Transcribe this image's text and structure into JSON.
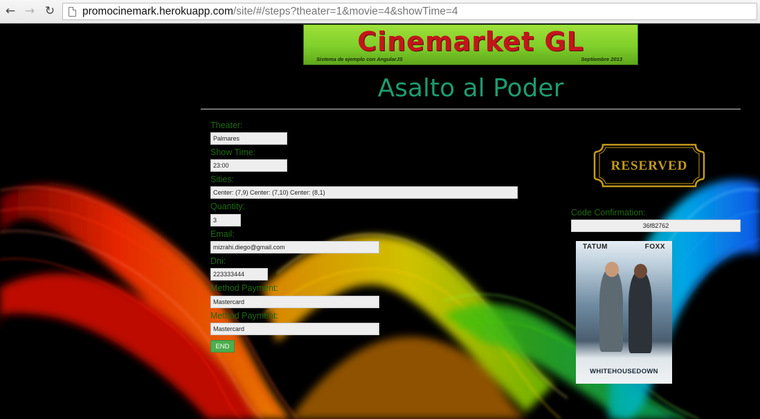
{
  "browser": {
    "url_host": "promocinemark.herokuapp.com",
    "url_path": "/site/#/steps?theater=1&movie=4&showTime=4"
  },
  "banner": {
    "title": "Cinemarket GL",
    "subtitle": "Sistema de ejemplo con AngularJS",
    "date": "Septiembre 2013"
  },
  "movie_title": "Asalto al Poder",
  "form": {
    "theater": {
      "label": "Theater:",
      "value": "Palmares"
    },
    "show_time": {
      "label": "Show Time:",
      "value": "23:00"
    },
    "sities": {
      "label": "Sities:",
      "value": "Center: (7,9) Center: (7,10) Center: (8,1)"
    },
    "quantity": {
      "label": "Quantity:",
      "value": "3"
    },
    "email": {
      "label": "Email:",
      "value": "mizrahi.diego@gmail.com"
    },
    "dni": {
      "label": "Dni:",
      "value": "223333444"
    },
    "method_payment_1": {
      "label": "Method Payment:",
      "value": "Mastercard"
    },
    "method_payment_2": {
      "label": "Method Payment:",
      "value": "Mastercard"
    },
    "end_button": "END"
  },
  "confirmation": {
    "stamp": "RESERVED",
    "code_label": "Code Confirmation:",
    "code_value": "36f82762"
  },
  "poster": {
    "actor_left": "TATUM",
    "actor_right": "FOXX",
    "title": "WHITEHOUSEDOWN"
  },
  "colors": {
    "label_green": "#1f6b12",
    "title_green": "#1e9b6e",
    "button_green": "#4cad4c",
    "banner_red": "#c4151c",
    "stamp_gold": "#c49a1c"
  }
}
